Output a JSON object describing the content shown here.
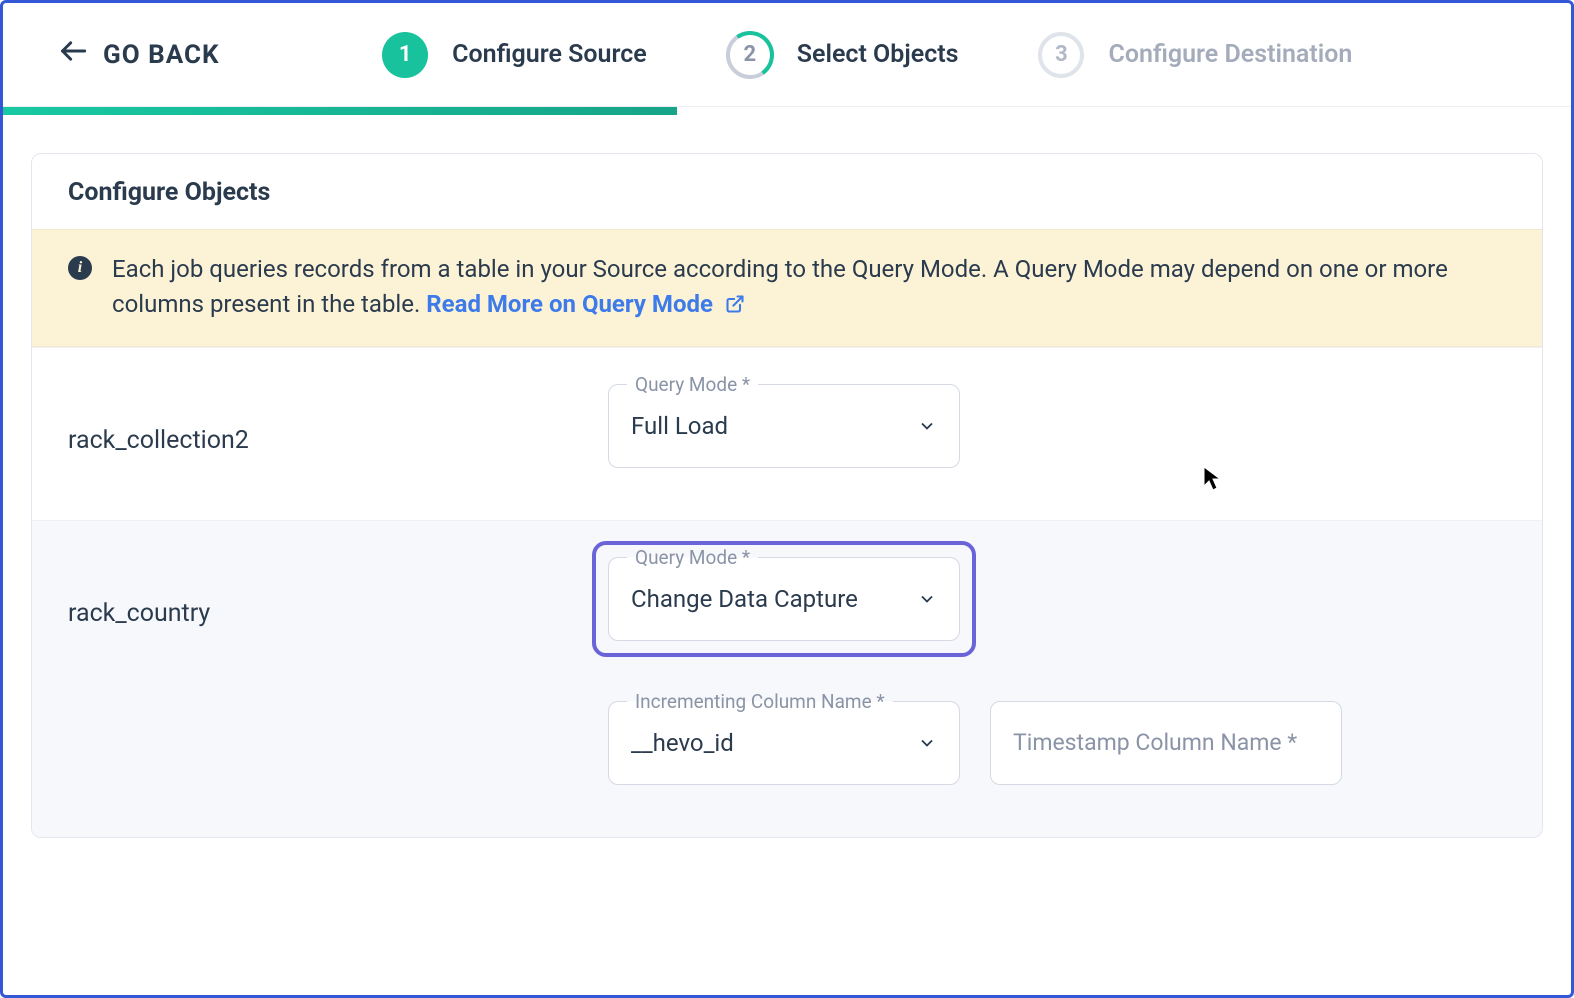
{
  "header": {
    "go_back_label": "GO BACK"
  },
  "stepper": {
    "steps": [
      {
        "num": "1",
        "label": "Configure Source"
      },
      {
        "num": "2",
        "label": "Select Objects"
      },
      {
        "num": "3",
        "label": "Configure Destination"
      }
    ]
  },
  "card": {
    "title": "Configure Objects"
  },
  "info": {
    "text": "Each job queries records from a table in your Source according to the Query Mode. A Query Mode may depend on one or more columns present in the table. ",
    "link_text": "Read More on Query Mode"
  },
  "objects": [
    {
      "name": "rack_collection2",
      "query_mode_label": "Query Mode *",
      "query_mode_value": "Full Load"
    },
    {
      "name": "rack_country",
      "query_mode_label": "Query Mode *",
      "query_mode_value": "Change Data Capture",
      "inc_col_label": "Incrementing Column Name *",
      "inc_col_value": "__hevo_id",
      "ts_col_placeholder": "Timestamp Column Name *"
    }
  ]
}
